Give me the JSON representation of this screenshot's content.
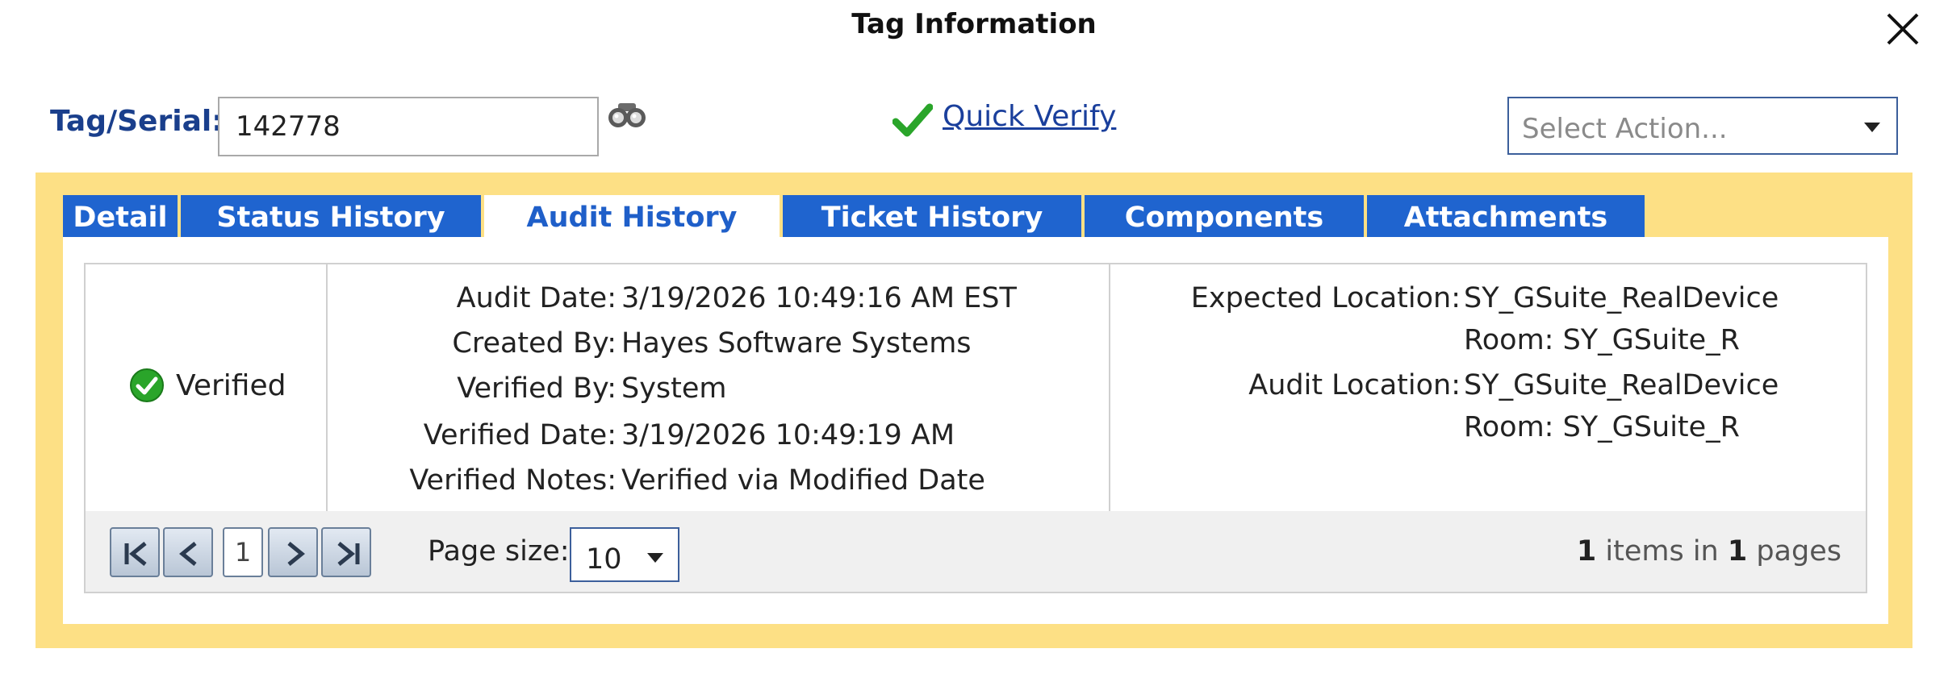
{
  "dialog": {
    "title": "Tag Information"
  },
  "tag": {
    "label": "Tag/Serial:",
    "value": "142778"
  },
  "quick_verify": {
    "label": "Quick Verify"
  },
  "select_action": {
    "placeholder": "Select Action..."
  },
  "tabs": [
    {
      "label": "Detail",
      "active": false
    },
    {
      "label": "Status History",
      "active": false
    },
    {
      "label": "Audit History",
      "active": true
    },
    {
      "label": "Ticket History",
      "active": false
    },
    {
      "label": "Components",
      "active": false
    },
    {
      "label": "Attachments",
      "active": false
    }
  ],
  "audit": {
    "status": "Verified",
    "details": [
      {
        "label": "Audit Date:",
        "value": "3/19/2026 10:49:16 AM EST"
      },
      {
        "label": "Created By:",
        "value": "Hayes Software Systems"
      },
      {
        "label": "Verified By:",
        "value": "System"
      },
      {
        "label": "Verified Date:",
        "value": "3/19/2026 10:49:19 AM"
      },
      {
        "label": "Verified Notes:",
        "value": "Verified via Modified Date"
      }
    ],
    "expected_location": {
      "label": "Expected Location:",
      "value": "SY_GSuite_RealDevice",
      "room": "Room: SY_GSuite_R"
    },
    "audit_location": {
      "label": "Audit Location:",
      "value": "SY_GSuite_RealDevice",
      "room": "Room: SY_GSuite_R"
    }
  },
  "pager": {
    "current_page": "1",
    "page_size_label": "Page size:",
    "page_size": "10",
    "items_count": "1",
    "items_text": " items in ",
    "pages_count": "1",
    "pages_text": " pages"
  },
  "colors": {
    "tab_blue": "#1f64cf",
    "frame_yellow": "#fde085",
    "label_blue": "#1a3f8c",
    "check_green": "#2aa52a"
  },
  "icons": {
    "close": "close-icon",
    "search": "binoculars-icon",
    "quick_verify": "checkmark-icon",
    "verified": "check-circle-icon"
  }
}
